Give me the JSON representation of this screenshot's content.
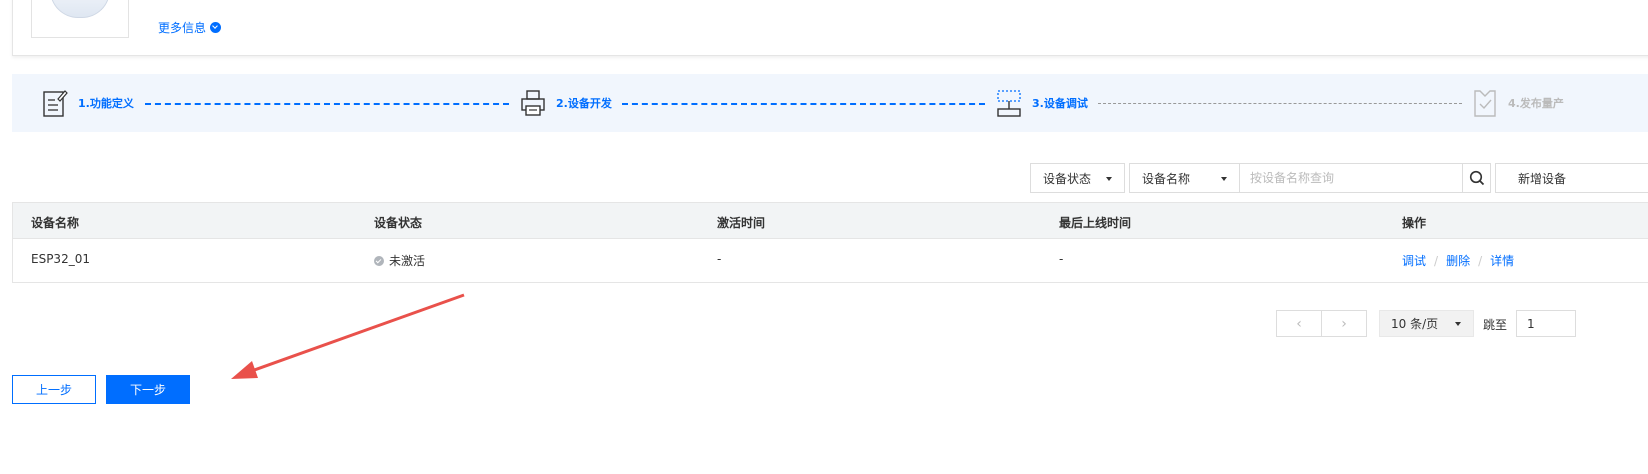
{
  "product": {
    "more_info": "更多信息"
  },
  "steps": [
    {
      "label": "1.功能定义",
      "state": "done"
    },
    {
      "label": "2.设备开发",
      "state": "done"
    },
    {
      "label": "3.设备调试",
      "state": "current"
    },
    {
      "label": "4.发布量产",
      "state": "todo"
    }
  ],
  "toolbar": {
    "status_filter": "设备状态",
    "field_select": "设备名称",
    "search_placeholder": "按设备名称查询",
    "add_button": "新增设备"
  },
  "table": {
    "columns": [
      "设备名称",
      "设备状态",
      "激活时间",
      "最后上线时间",
      "操作"
    ],
    "rows": [
      {
        "name": "ESP32_01",
        "status": "未激活",
        "activated": "-",
        "last_online": "-",
        "actions": [
          "调试",
          "删除",
          "详情"
        ]
      }
    ]
  },
  "pagination": {
    "prev": "‹",
    "next": "›",
    "page_size": "10 条/页",
    "jump_label": "跳至",
    "jump_value": "1"
  },
  "footer": {
    "prev_step": "上一步",
    "next_step": "下一步"
  },
  "colors": {
    "accent": "#006eff",
    "annotation_arrow": "#e9514b"
  }
}
